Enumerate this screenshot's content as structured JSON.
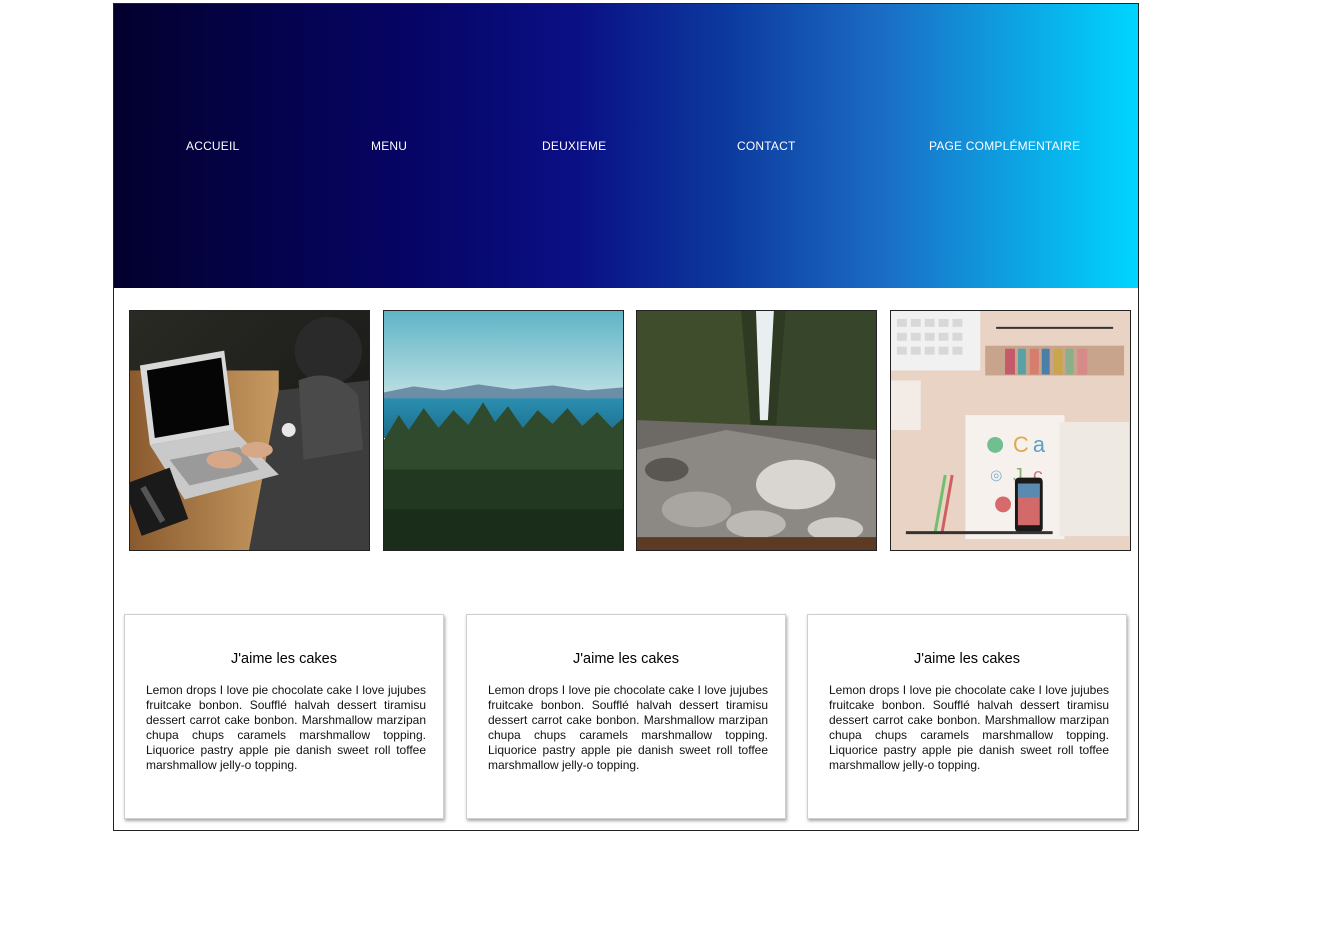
{
  "nav": {
    "items": [
      "ACCUEIL",
      "MENU",
      "DEUXIEME",
      "CONTACT",
      "PAGE COMPLÉMENTAIRE"
    ]
  },
  "gallery": {
    "images": [
      "laptop-photo",
      "forest-lake-photo",
      "waterfall-photo",
      "desk-books-photo"
    ]
  },
  "cards": [
    {
      "title": "J'aime les cakes",
      "text": "Lemon drops I love pie chocolate cake I love jujubes fruitcake bonbon. Soufflé halvah dessert tiramisu dessert carrot cake bonbon. Marshmallow marzipan chupa chups caramels marshmallow topping. Liquorice pastry apple pie danish sweet roll toffee marshmallow jelly-o topping."
    },
    {
      "title": "J'aime les cakes",
      "text": "Lemon drops I love pie chocolate cake I love jujubes fruitcake bonbon. Soufflé halvah dessert tiramisu dessert carrot cake bonbon. Marshmallow marzipan chupa chups caramels marshmallow topping. Liquorice pastry apple pie danish sweet roll toffee marshmallow jelly-o topping."
    },
    {
      "title": "J'aime les cakes",
      "text": "Lemon drops I love pie chocolate cake I love jujubes fruitcake bonbon. Soufflé halvah dessert tiramisu dessert carrot cake bonbon. Marshmallow marzipan chupa chups caramels marshmallow topping. Liquorice pastry apple pie danish sweet roll toffee marshmallow jelly-o topping."
    }
  ],
  "colors": {
    "header_gradient_start": "#03002e",
    "header_gradient_mid": "#0a0f84",
    "header_gradient_end": "#00d5ff",
    "nav_text": "#ffffff"
  }
}
